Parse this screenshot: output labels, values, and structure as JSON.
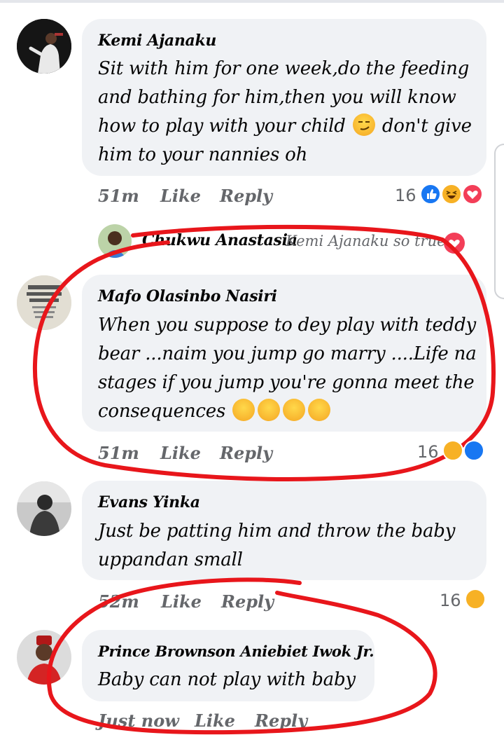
{
  "comments": [
    {
      "author": "Kemi Ajanaku",
      "lines": [
        "Sit with him for one week,do the feeding",
        "and bathing for him,then you will know",
        "how to play with your child",
        "don't give",
        "him to your nannies oh"
      ],
      "time": "51m",
      "like_label": "Like",
      "reply_label": "Reply",
      "reaction_count": "16",
      "reaction_icons": [
        "like-icon",
        "haha-icon",
        "love-icon"
      ]
    },
    {
      "collapsed_reply": {
        "author": "Chukwu Anastasia",
        "preview": "Kemi Ajanaku so true"
      }
    },
    {
      "author": "Mafo Olasinbo Nasiri",
      "lines": [
        "When you suppose to dey play with teddy",
        "bear ...naim you jump go marry ....Life na",
        "stages if you jump you're gonna meet the",
        "consequences"
      ],
      "time": "51m",
      "like_label": "Like",
      "reply_label": "Reply",
      "reaction_count": "16",
      "reaction_icons": [
        "haha-icon",
        "like-icon"
      ]
    },
    {
      "author": "Evans Yinka",
      "lines": [
        "Just be patting him and throw the baby",
        "uppandan small"
      ],
      "time": "52m",
      "like_label": "Like",
      "reply_label": "Reply",
      "reaction_count": "16",
      "reaction_icons": [
        "haha-icon"
      ]
    },
    {
      "author": "Prince Brownson Aniebiet Iwok Jr.",
      "lines": [
        "Baby can not play with baby"
      ],
      "time": "Just now",
      "like_label": "Like",
      "reply_label": "Reply"
    }
  ],
  "colors": {
    "bubble": "#f0f2f5",
    "meta_text": "#65676b",
    "like_blue": "#1877f2",
    "haha_yellow": "#f7b125",
    "love_red": "#f33e58",
    "annotation_red": "#e8161b"
  }
}
